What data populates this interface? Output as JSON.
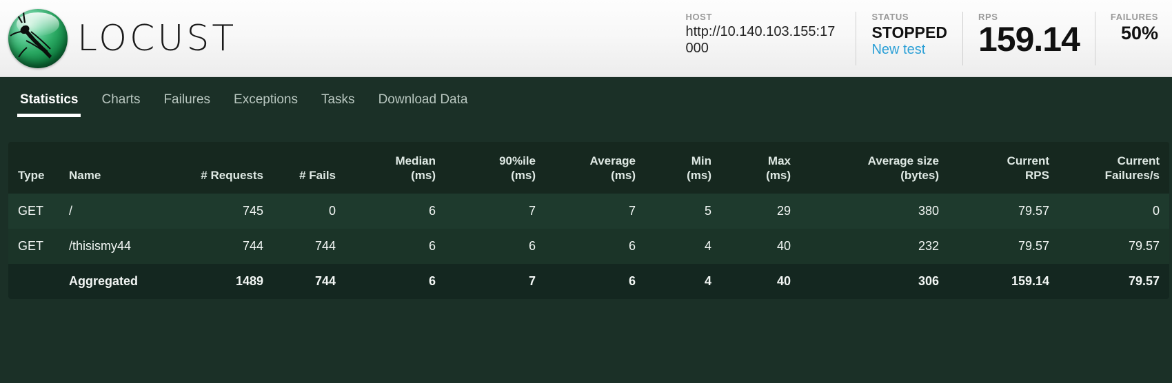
{
  "brand": {
    "name": "LOCUST",
    "logo_icon": "locust-logo-icon"
  },
  "header": {
    "host": {
      "label": "HOST",
      "value": "http://10.140.103.155:17000"
    },
    "status": {
      "label": "STATUS",
      "value": "STOPPED",
      "link": "New test"
    },
    "rps": {
      "label": "RPS",
      "value": "159.14"
    },
    "failures": {
      "label": "FAILURES",
      "value": "50%"
    }
  },
  "nav": {
    "tabs": [
      {
        "label": "Statistics",
        "active": true
      },
      {
        "label": "Charts",
        "active": false
      },
      {
        "label": "Failures",
        "active": false
      },
      {
        "label": "Exceptions",
        "active": false
      },
      {
        "label": "Tasks",
        "active": false
      },
      {
        "label": "Download Data",
        "active": false
      }
    ]
  },
  "table": {
    "columns": [
      {
        "line1": "Type",
        "line2": "",
        "align": "left"
      },
      {
        "line1": "Name",
        "line2": "",
        "align": "left"
      },
      {
        "line1": "# Requests",
        "line2": "",
        "align": "right"
      },
      {
        "line1": "# Fails",
        "line2": "",
        "align": "right"
      },
      {
        "line1": "Median",
        "line2": "(ms)",
        "align": "right"
      },
      {
        "line1": "90%ile",
        "line2": "(ms)",
        "align": "right"
      },
      {
        "line1": "Average",
        "line2": "(ms)",
        "align": "right"
      },
      {
        "line1": "Min",
        "line2": "(ms)",
        "align": "right"
      },
      {
        "line1": "Max",
        "line2": "(ms)",
        "align": "right"
      },
      {
        "line1": "Average size",
        "line2": "(bytes)",
        "align": "right"
      },
      {
        "line1": "Current",
        "line2": "RPS",
        "align": "right"
      },
      {
        "line1": "Current",
        "line2": "Failures/s",
        "align": "right"
      }
    ],
    "rows": [
      {
        "type": "GET",
        "name": "/",
        "requests": "745",
        "fails": "0",
        "median": "6",
        "p90": "7",
        "average": "7",
        "min": "5",
        "max": "29",
        "avg_size": "380",
        "current_rps": "79.57",
        "current_failures": "0"
      },
      {
        "type": "GET",
        "name": "/thisismy44",
        "requests": "744",
        "fails": "744",
        "median": "6",
        "p90": "6",
        "average": "6",
        "min": "4",
        "max": "40",
        "avg_size": "232",
        "current_rps": "79.57",
        "current_failures": "79.57"
      },
      {
        "type": "",
        "name": "Aggregated",
        "requests": "1489",
        "fails": "744",
        "median": "6",
        "p90": "7",
        "average": "6",
        "min": "4",
        "max": "40",
        "avg_size": "306",
        "current_rps": "159.14",
        "current_failures": "79.57"
      }
    ]
  },
  "colors": {
    "page_bg": "#1b3027",
    "header_bg": "#f5f5f5",
    "table_header_bg": "#16281f",
    "row_odd": "#1e3a2d",
    "row_even": "#1b3428",
    "total_row": "#142720",
    "link_blue": "#2a9fd6",
    "active_tab": "#ffffff"
  }
}
